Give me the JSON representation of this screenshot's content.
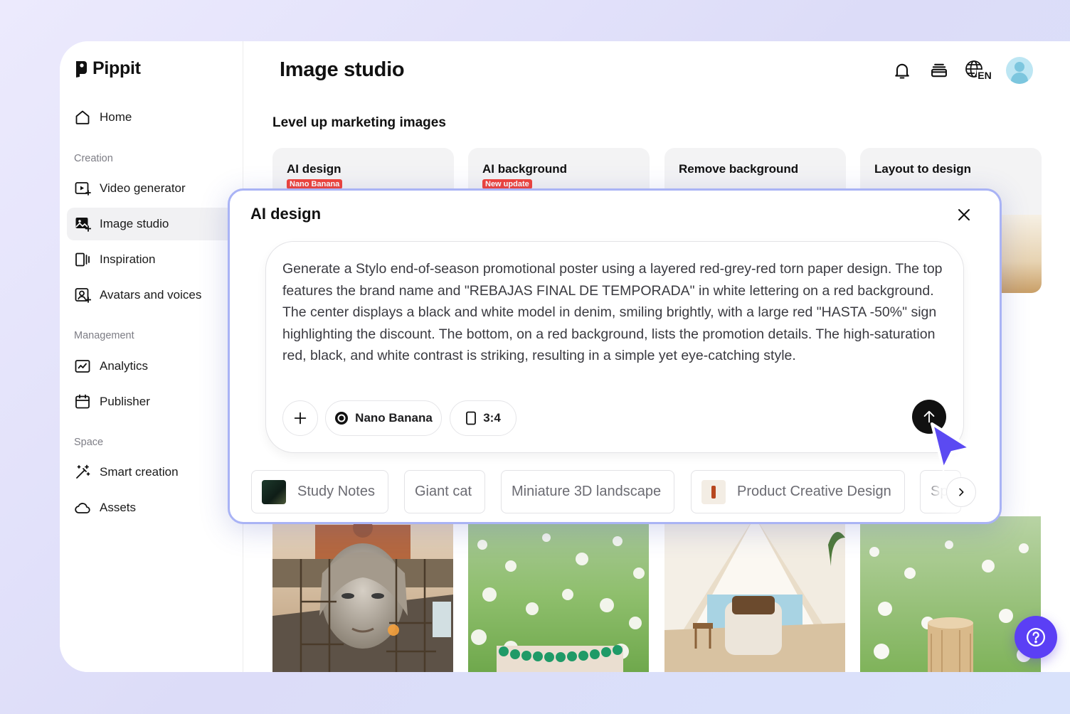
{
  "brand": {
    "name": "Pippit"
  },
  "sidebar": {
    "home": "Home",
    "sections": {
      "creation": "Creation",
      "management": "Management",
      "space": "Space"
    },
    "items": {
      "video_generator": "Video generator",
      "image_studio": "Image studio",
      "inspiration": "Inspiration",
      "avatars_voices": "Avatars and voices",
      "analytics": "Analytics",
      "publisher": "Publisher",
      "smart_creation": "Smart creation",
      "assets": "Assets"
    },
    "active": "image_studio"
  },
  "header": {
    "title": "Image studio",
    "language": "EN"
  },
  "main": {
    "section_title": "Level up marketing images",
    "tools": [
      {
        "title": "AI design",
        "badge": "Nano Banana"
      },
      {
        "title": "AI background",
        "badge": "New update"
      },
      {
        "title": "Remove background"
      },
      {
        "title": "Layout to design"
      }
    ]
  },
  "modal": {
    "title": "AI design",
    "prompt": "Generate a Stylo end-of-season promotional poster using a layered red-grey-red torn paper design. The top features the brand name and \"REBAJAS FINAL DE TEMPORADA\" in white lettering on a red background. The center displays a black and white model in denim, smiling brightly, with a large red \"HASTA -50%\" sign highlighting the discount. The bottom, on a red background, lists the promotion details. The high-saturation red, black, and white contrast is striking, resulting in a simple yet eye-catching style.",
    "model_label": "Nano Banana",
    "ratio_label": "3:4",
    "suggestions": [
      "Study Notes",
      "Giant cat",
      "Miniature 3D landscape",
      "Product Creative Design",
      "Sp"
    ]
  },
  "colors": {
    "accent": "#5b3ff5",
    "modal_border": "#a9b3f5",
    "badge": "#f0433a"
  }
}
